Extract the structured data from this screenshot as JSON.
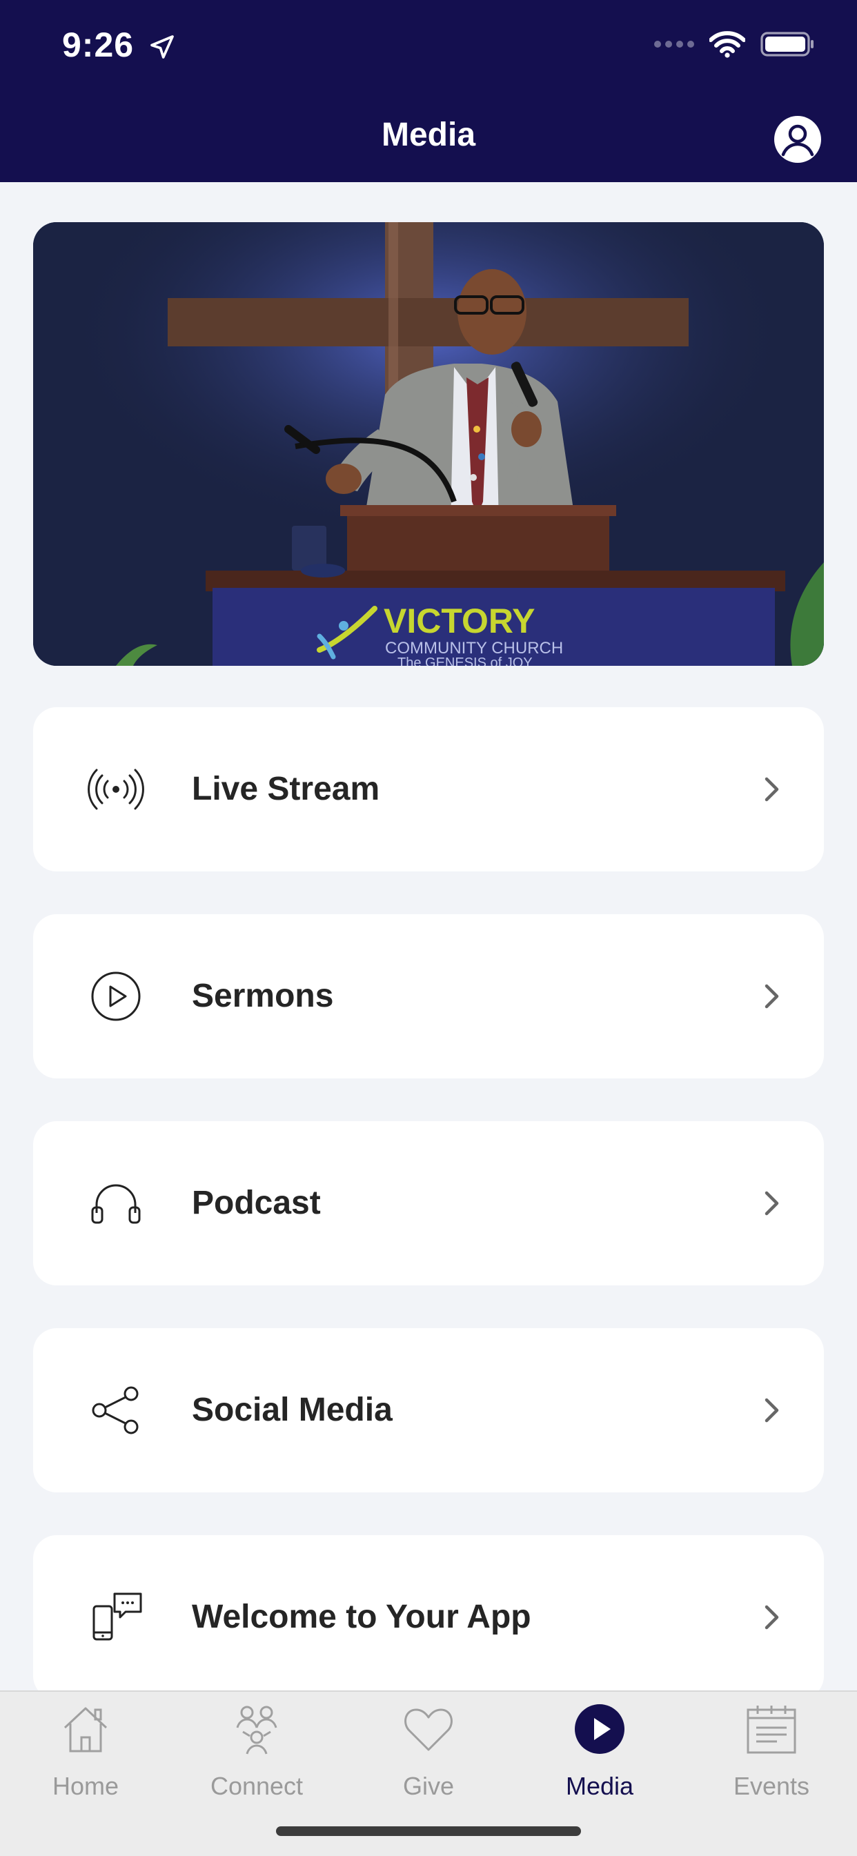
{
  "status_bar": {
    "time": "9:26"
  },
  "header": {
    "title": "Media"
  },
  "hero": {
    "church_name": "VICTORY",
    "church_subtitle": "COMMUNITY CHURCH",
    "church_tagline": "The GENESIS of JOY"
  },
  "menu": [
    {
      "label": "Live Stream",
      "icon": "broadcast-icon"
    },
    {
      "label": "Sermons",
      "icon": "play-circle-icon"
    },
    {
      "label": "Podcast",
      "icon": "headphones-icon"
    },
    {
      "label": "Social Media",
      "icon": "share-icon"
    },
    {
      "label": "Welcome to Your App",
      "icon": "phone-chat-icon"
    }
  ],
  "tabbar": {
    "active": "Media",
    "tabs": [
      {
        "label": "Home",
        "icon": "home-icon"
      },
      {
        "label": "Connect",
        "icon": "people-icon"
      },
      {
        "label": "Give",
        "icon": "heart-icon"
      },
      {
        "label": "Media",
        "icon": "play-circle-filled-icon"
      },
      {
        "label": "Events",
        "icon": "calendar-icon"
      }
    ]
  },
  "colors": {
    "brand_navy": "#140f4f",
    "background": "#f2f4f8",
    "hero_accent_green": "#c7d630"
  }
}
